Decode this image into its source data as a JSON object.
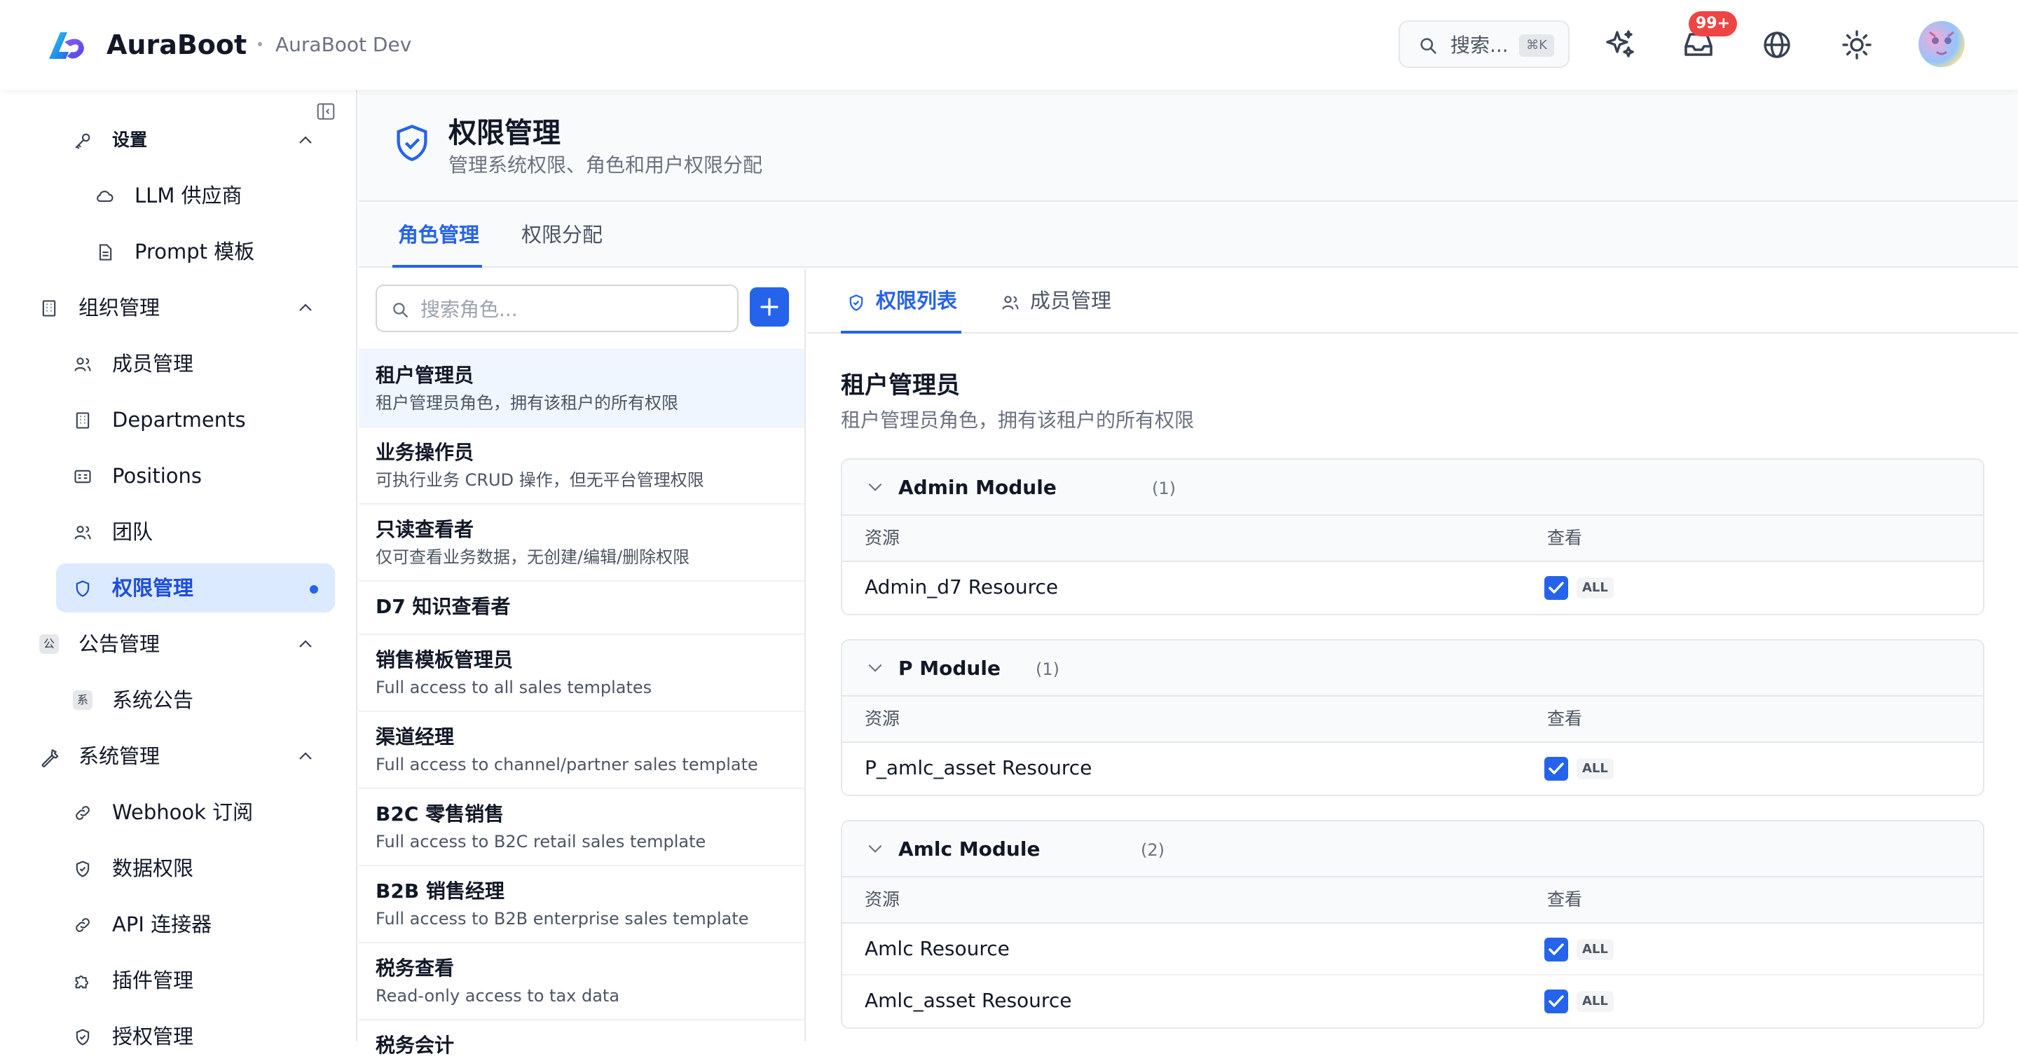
{
  "header": {
    "app_name": "AuraBoot",
    "env_name": "AuraBoot Dev",
    "search_label": "搜索...",
    "search_shortcut": "⌘K",
    "notification_count": "99+",
    "icons": [
      "sparkles-icon",
      "inbox-icon",
      "globe-icon",
      "sun-icon"
    ]
  },
  "sidebar": {
    "items": [
      {
        "label": "设置",
        "icon": "key-icon",
        "level": 2,
        "expanded": true
      },
      {
        "label": "LLM 供应商",
        "icon": "cloud-icon",
        "level": 3
      },
      {
        "label": "Prompt 模板",
        "icon": "file-icon",
        "level": 3
      },
      {
        "label": "组织管理",
        "icon": "building-icon",
        "level": 1,
        "expanded": true
      },
      {
        "label": "成员管理",
        "icon": "users-icon",
        "level": 2
      },
      {
        "label": "Departments",
        "icon": "building-icon",
        "level": 2
      },
      {
        "label": "Positions",
        "icon": "id-card-icon",
        "level": 2
      },
      {
        "label": "团队",
        "icon": "users-icon",
        "level": 2
      },
      {
        "label": "权限管理",
        "icon": "shield-icon",
        "level": 2,
        "active": true
      },
      {
        "label": "公告管理",
        "icon": "char-公",
        "level": 1,
        "expanded": true
      },
      {
        "label": "系统公告",
        "icon": "char-系",
        "level": 2
      },
      {
        "label": "系统管理",
        "icon": "wrench-icon",
        "level": 1,
        "expanded": true
      },
      {
        "label": "Webhook 订阅",
        "icon": "link-icon",
        "level": 2
      },
      {
        "label": "数据权限",
        "icon": "shield-icon",
        "level": 2
      },
      {
        "label": "API 连接器",
        "icon": "link-icon",
        "level": 2
      },
      {
        "label": "插件管理",
        "icon": "puzzle-icon",
        "level": 2
      },
      {
        "label": "授权管理",
        "icon": "shield-icon",
        "level": 2
      }
    ],
    "char_badges": {
      "announce": "公",
      "system": "系"
    }
  },
  "page": {
    "title": "权限管理",
    "subtitle": "管理系统权限、角色和用户权限分配",
    "tabs": [
      {
        "label": "角色管理",
        "active": true
      },
      {
        "label": "权限分配",
        "active": false
      }
    ]
  },
  "roles": {
    "search_placeholder": "搜索角色...",
    "items": [
      {
        "name": "租户管理员",
        "desc": "租户管理员角色，拥有该租户的所有权限",
        "selected": true
      },
      {
        "name": "业务操作员",
        "desc": "可执行业务 CRUD 操作，但无平台管理权限"
      },
      {
        "name": "只读查看者",
        "desc": "仅可查看业务数据，无创建/编辑/删除权限"
      },
      {
        "name": "D7 知识查看者",
        "desc": ""
      },
      {
        "name": "销售模板管理员",
        "desc": "Full access to all sales templates"
      },
      {
        "name": "渠道经理",
        "desc": "Full access to channel/partner sales template"
      },
      {
        "name": "B2C 零售销售",
        "desc": "Full access to B2C retail sales template"
      },
      {
        "name": "B2B 销售经理",
        "desc": "Full access to B2B enterprise sales template"
      },
      {
        "name": "税务查看",
        "desc": "Read-only access to tax data"
      },
      {
        "name": "税务会计",
        "desc": ""
      }
    ]
  },
  "detail": {
    "tabs": [
      {
        "label": "权限列表",
        "icon": "shield-check-icon",
        "active": true
      },
      {
        "label": "成员管理",
        "icon": "users-icon",
        "active": false
      }
    ],
    "role_name": "租户管理员",
    "role_desc": "租户管理员角色，拥有该租户的所有权限",
    "col_resource": "资源",
    "col_view": "查看",
    "modules": [
      {
        "name": "Admin Module",
        "count": "(1)",
        "resources": [
          {
            "name": "Admin_d7 Resource",
            "view": true,
            "scope": "ALL"
          }
        ]
      },
      {
        "name": "P Module",
        "count": "(1)",
        "resources": [
          {
            "name": "P_amlc_asset Resource",
            "view": true,
            "scope": "ALL"
          }
        ]
      },
      {
        "name": "Amlc Module",
        "count": "(2)",
        "resources": [
          {
            "name": "Amlc Resource",
            "view": true,
            "scope": "ALL"
          },
          {
            "name": "Amlc_asset Resource",
            "view": true,
            "scope": "ALL"
          }
        ]
      }
    ]
  },
  "colors": {
    "accent": "#2563eb",
    "active_bg": "#dbeafe",
    "badge_red": "#ef4444"
  }
}
